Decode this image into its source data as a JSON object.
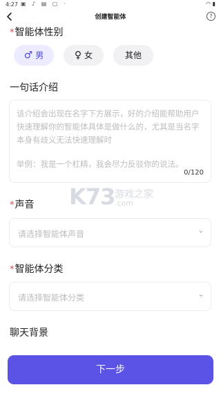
{
  "status_bar": {
    "time": "4:27"
  },
  "nav": {
    "title": "创建智能体",
    "help": "?"
  },
  "gender": {
    "label": "智能体性别",
    "required_mark": "*",
    "options": [
      {
        "symbol": "♂",
        "label": "男",
        "selected": true
      },
      {
        "symbol": "♀",
        "label": "女",
        "selected": false
      },
      {
        "label": "其他",
        "selected": false
      }
    ]
  },
  "intro": {
    "label": "一句话介绍",
    "placeholder": "该介绍会出现在名字下方展示，好的介绍能帮助用户快速理解你的智能体具体是做什么的，尤其是当名字本身有歧义无法快速理解时",
    "example": "举例：我是一个杠精，我会尽力反驳你的说法。",
    "counter": "0/120"
  },
  "voice": {
    "label": "声音",
    "required_mark": "*",
    "placeholder": "请选择智能体声音"
  },
  "category": {
    "label": "智能体分类",
    "required_mark": "*",
    "placeholder": "请选择智能体分类"
  },
  "background": {
    "label": "聊天背景"
  },
  "watermark": {
    "logo": "K73",
    "site": "游戏之家",
    "domain": ".com"
  },
  "footer": {
    "next_label": "下一步"
  },
  "colors": {
    "accent": "#5b52e6",
    "required": "#e5484d",
    "chip_selected_bg": "#ecebff"
  }
}
